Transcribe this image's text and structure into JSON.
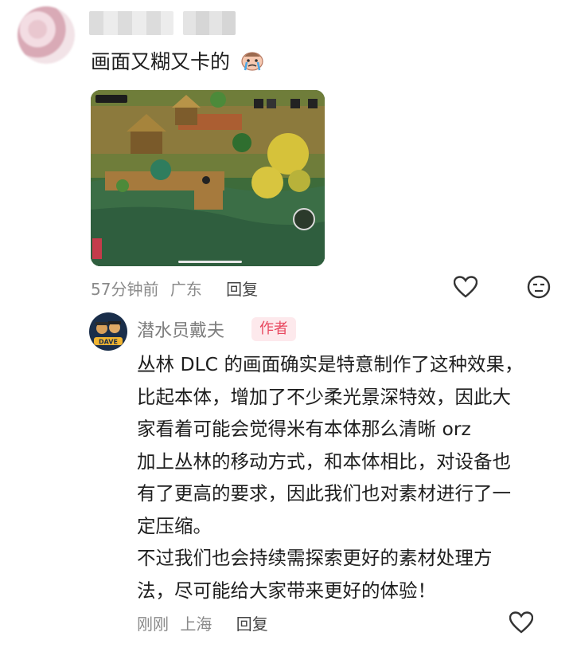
{
  "comment": {
    "text": "画面又糊又卡的",
    "emoji": "crying-face-emoji",
    "time": "57分钟前",
    "location": "广东",
    "reply_label": "回复"
  },
  "reply": {
    "author": "潜水员戴夫",
    "badge": "作者",
    "avatar_text": "DAVE",
    "lines": [
      "丛林 DLC 的画面确实是特意制作了这种效果，",
      "比起本体，增加了不少柔光景深特效，因此大",
      "家看着可能会觉得米有本体那么清晰 orz",
      "加上丛林的移动方式，和本体相比，对设备也",
      "有了更高的要求，因此我们也对素材进行了一",
      "定压缩。",
      "不过我们也会持续需探索更好的素材处理方",
      "法，尽可能给大家带来更好的体验！"
    ],
    "time": "刚刚",
    "location": "上海",
    "reply_label": "回复"
  },
  "colors": {
    "badge_bg": "#fde9ec",
    "badge_text": "#e8485f",
    "meta_text": "#8a8a8a"
  }
}
